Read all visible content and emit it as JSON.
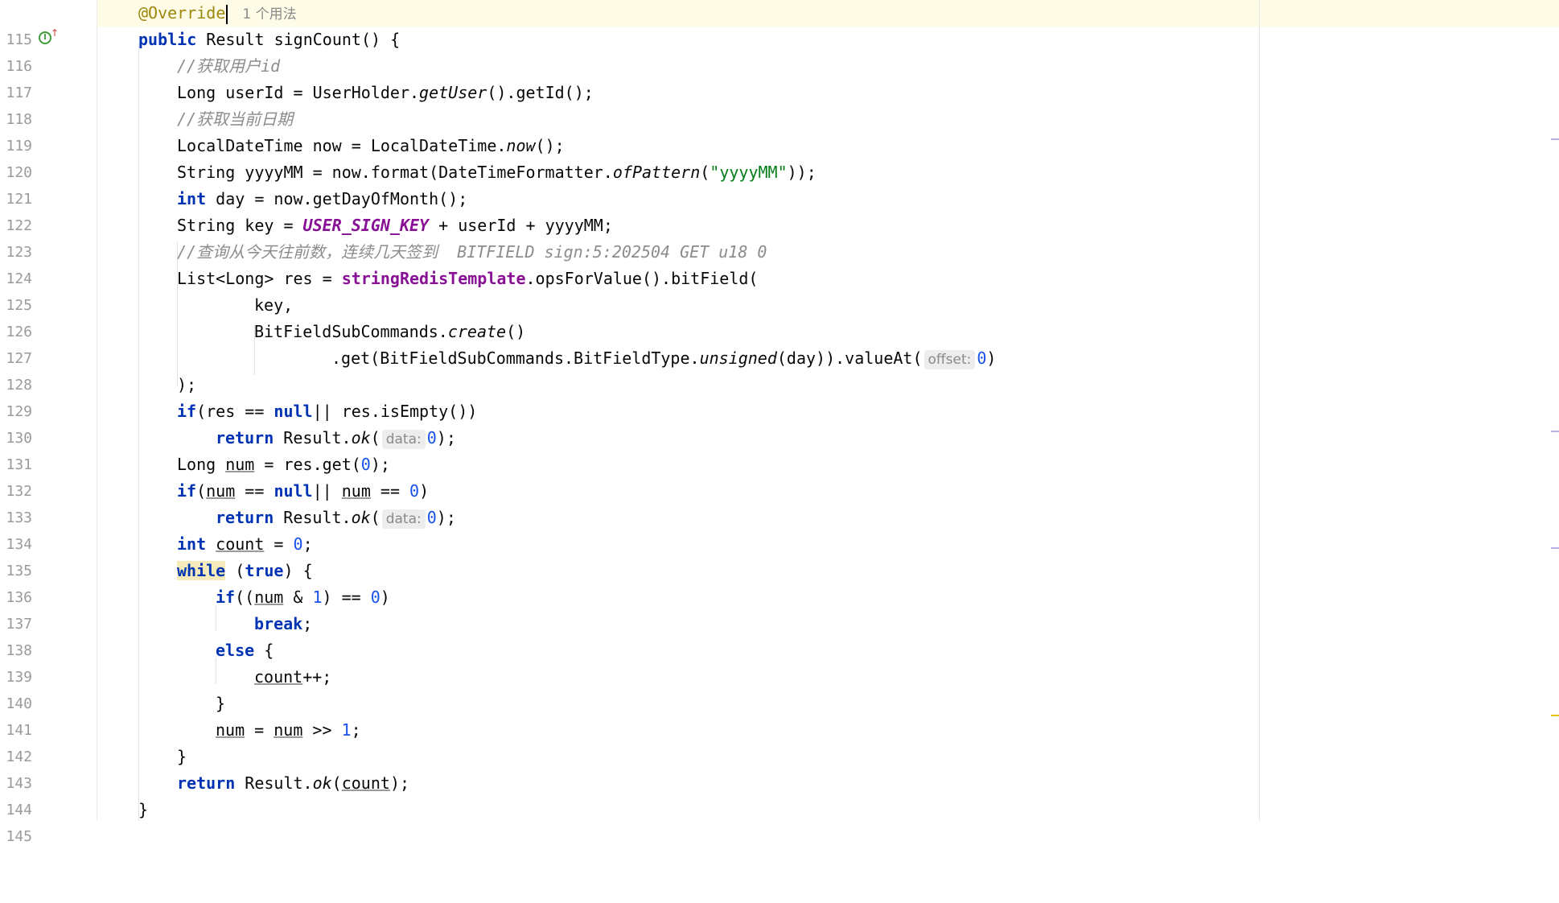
{
  "editor": {
    "usage_hint": "1 个用法",
    "gutter_icon": "implementation-up-arrow-icon",
    "lines": [
      {
        "n": "115"
      },
      {
        "n": "116"
      },
      {
        "n": "117"
      },
      {
        "n": "118"
      },
      {
        "n": "119"
      },
      {
        "n": "120"
      },
      {
        "n": "121"
      },
      {
        "n": "122"
      },
      {
        "n": "123"
      },
      {
        "n": "124"
      },
      {
        "n": "125"
      },
      {
        "n": "126"
      },
      {
        "n": "127"
      },
      {
        "n": "128"
      },
      {
        "n": "129"
      },
      {
        "n": "130"
      },
      {
        "n": "131"
      },
      {
        "n": "132"
      },
      {
        "n": "133"
      },
      {
        "n": "134"
      },
      {
        "n": "135"
      },
      {
        "n": "136"
      },
      {
        "n": "137"
      },
      {
        "n": "138"
      },
      {
        "n": "139"
      },
      {
        "n": "140"
      },
      {
        "n": "141"
      },
      {
        "n": "142"
      },
      {
        "n": "143"
      },
      {
        "n": "144"
      },
      {
        "n": "145"
      }
    ],
    "tokens": {
      "override": "@Override",
      "sig_public": "public",
      "sig_rest": " Result signCount() {",
      "c117": "//获取用户id",
      "l118a": "Long userId = UserHolder.",
      "l118b": "getUser",
      "l118c": "().getId();",
      "c119": "//获取当前日期",
      "l120a": "LocalDateTime now = LocalDateTime.",
      "l120b": "now",
      "l120c": "();",
      "l121a": "String yyyyMM = now.format(DateTimeFormatter.",
      "l121b": "ofPattern",
      "l121c": "(",
      "l121d": "\"yyyyMM\"",
      "l121e": "));",
      "l122a": "int",
      "l122b": " day = now.getDayOfMonth();",
      "l123a": "String key = ",
      "l123b": "USER_SIGN_KEY",
      "l123c": " + userId + yyyyMM;",
      "c124": "//查询从今天往前数，连续几天签到  BITFIELD sign:5:202504 GET u18 0",
      "l125a": "List<Long> res = ",
      "l125b": "stringRedisTemplate",
      "l125c": ".opsForValue().bitField(",
      "l126": "key,",
      "l127a": "BitFieldSubCommands.",
      "l127b": "create",
      "l127c": "()",
      "l128a": ".get(BitFieldSubCommands.BitFieldType.",
      "l128b": "unsigned",
      "l128c": "(day)).valueAt(",
      "hint_offset": "offset:",
      "l128d": "0",
      "l128e": ")",
      "l129": ");",
      "if": "if",
      "l130a": "(res == ",
      "null": "null",
      "l130b": "|| res.isEmpty())",
      "return": "return",
      "result_ok_a": " Result.",
      "ok": "ok",
      "paren_open": "(",
      "hint_data": "data:",
      "zero": "0",
      "close_semi": ");",
      "l132a": "Long ",
      "num": "num",
      "l132b": " = res.get(",
      "l133a": "(",
      "l133b": " == ",
      "l133c": "|| ",
      "l133d": " == ",
      "l133e": ")",
      "int": "int",
      "count": "count",
      "l135b": " = ",
      "semi": ";",
      "while": "while",
      "l136a": " (",
      "true": "true",
      "l136b": ") {",
      "l137a": "((",
      "l137b": " & ",
      "one": "1",
      "l137c": ") == ",
      "l137d": ")",
      "break": "break",
      "else": "else",
      "l139b": " {",
      "l140b": "++;",
      "brace_close": "}",
      "l142b": " = ",
      "l142c": " >> ",
      "l144b": "(",
      "l144c": ");"
    }
  },
  "colors": {
    "keyword": "#0033b3",
    "number": "#1750eb",
    "string": "#067d17",
    "comment": "#8c8c8c",
    "annotation": "#9e880d",
    "field": "#871094"
  }
}
